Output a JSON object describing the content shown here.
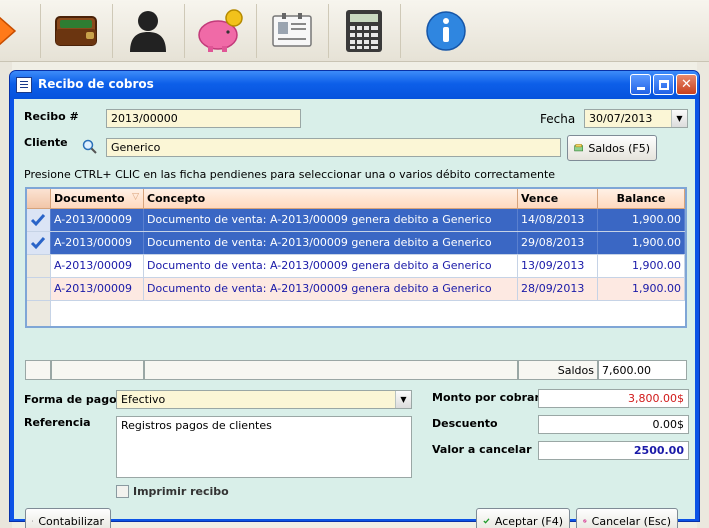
{
  "app": {
    "toolbar_icons": [
      "arrow-icon",
      "wallet-icon",
      "user-icon",
      "piggy-bank-icon",
      "contact-card-icon",
      "calculator-icon",
      "info-icon"
    ]
  },
  "dialog": {
    "title": "Recibo de cobros",
    "recibo_label": "Recibo #",
    "recibo_value": "2013/00000",
    "fecha_label": "Fecha",
    "fecha_value": "30/07/2013",
    "cliente_label": "Cliente",
    "cliente_value": "Generico",
    "saldos_button": "Saldos (F5)",
    "hint": "Presione CTRL+ CLIC en las ficha pendienes para seleccionar una o varios débito correctamente",
    "grid": {
      "headers": [
        "Documento",
        "Concepto",
        "Vence",
        "Balance"
      ],
      "rows": [
        {
          "documento": "A-2013/00009",
          "concepto": "Documento de venta: A-2013/00009 genera debito a Generico",
          "vence": "14/08/2013",
          "balance": "1,900.00",
          "checked": true
        },
        {
          "documento": "A-2013/00009",
          "concepto": "Documento de venta: A-2013/00009 genera debito a Generico",
          "vence": "29/08/2013",
          "balance": "1,900.00",
          "checked": true
        },
        {
          "documento": "A-2013/00009",
          "concepto": "Documento de venta: A-2013/00009 genera debito a Generico",
          "vence": "13/09/2013",
          "balance": "1,900.00",
          "checked": false
        },
        {
          "documento": "A-2013/00009",
          "concepto": "Documento de venta: A-2013/00009 genera debito a Generico",
          "vence": "28/09/2013",
          "balance": "1,900.00",
          "checked": false
        }
      ],
      "footer_label": "Saldos",
      "footer_value": "7,600.00"
    },
    "forma_pago_label": "Forma de pago",
    "forma_pago_value": "Efectivo",
    "referencia_label": "Referencia",
    "referencia_value": "Registros pagos de clientes",
    "imprimir_label": "Imprimir recibo",
    "monto_label": "Monto por cobrar",
    "monto_value": "3,800.00$",
    "descuento_label": "Descuento",
    "descuento_value": "0.00$",
    "valor_label": "Valor a  cancelar",
    "valor_value": "2500.00",
    "contabilizar_button": "Contabilizar",
    "aceptar_button": "Aceptar (F4)",
    "cancelar_button": "Cancelar (Esc)",
    "colors": {
      "title_blue": "#0b53e6",
      "client_bg": "#d9efe9",
      "selected_row": "#3a67c4",
      "monto_red": "#d11a1a",
      "valor_blue": "#1a1aa8"
    }
  }
}
